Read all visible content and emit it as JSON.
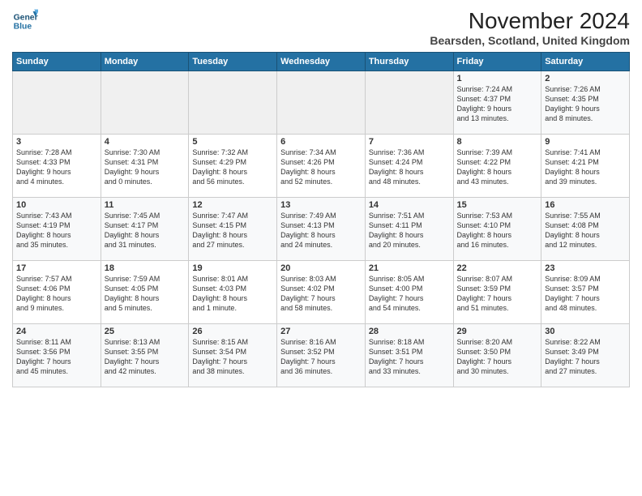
{
  "logo": {
    "line1": "General",
    "line2": "Blue"
  },
  "title": "November 2024",
  "location": "Bearsden, Scotland, United Kingdom",
  "headers": [
    "Sunday",
    "Monday",
    "Tuesday",
    "Wednesday",
    "Thursday",
    "Friday",
    "Saturday"
  ],
  "weeks": [
    [
      {
        "day": "",
        "info": ""
      },
      {
        "day": "",
        "info": ""
      },
      {
        "day": "",
        "info": ""
      },
      {
        "day": "",
        "info": ""
      },
      {
        "day": "",
        "info": ""
      },
      {
        "day": "1",
        "info": "Sunrise: 7:24 AM\nSunset: 4:37 PM\nDaylight: 9 hours\nand 13 minutes."
      },
      {
        "day": "2",
        "info": "Sunrise: 7:26 AM\nSunset: 4:35 PM\nDaylight: 9 hours\nand 8 minutes."
      }
    ],
    [
      {
        "day": "3",
        "info": "Sunrise: 7:28 AM\nSunset: 4:33 PM\nDaylight: 9 hours\nand 4 minutes."
      },
      {
        "day": "4",
        "info": "Sunrise: 7:30 AM\nSunset: 4:31 PM\nDaylight: 9 hours\nand 0 minutes."
      },
      {
        "day": "5",
        "info": "Sunrise: 7:32 AM\nSunset: 4:29 PM\nDaylight: 8 hours\nand 56 minutes."
      },
      {
        "day": "6",
        "info": "Sunrise: 7:34 AM\nSunset: 4:26 PM\nDaylight: 8 hours\nand 52 minutes."
      },
      {
        "day": "7",
        "info": "Sunrise: 7:36 AM\nSunset: 4:24 PM\nDaylight: 8 hours\nand 48 minutes."
      },
      {
        "day": "8",
        "info": "Sunrise: 7:39 AM\nSunset: 4:22 PM\nDaylight: 8 hours\nand 43 minutes."
      },
      {
        "day": "9",
        "info": "Sunrise: 7:41 AM\nSunset: 4:21 PM\nDaylight: 8 hours\nand 39 minutes."
      }
    ],
    [
      {
        "day": "10",
        "info": "Sunrise: 7:43 AM\nSunset: 4:19 PM\nDaylight: 8 hours\nand 35 minutes."
      },
      {
        "day": "11",
        "info": "Sunrise: 7:45 AM\nSunset: 4:17 PM\nDaylight: 8 hours\nand 31 minutes."
      },
      {
        "day": "12",
        "info": "Sunrise: 7:47 AM\nSunset: 4:15 PM\nDaylight: 8 hours\nand 27 minutes."
      },
      {
        "day": "13",
        "info": "Sunrise: 7:49 AM\nSunset: 4:13 PM\nDaylight: 8 hours\nand 24 minutes."
      },
      {
        "day": "14",
        "info": "Sunrise: 7:51 AM\nSunset: 4:11 PM\nDaylight: 8 hours\nand 20 minutes."
      },
      {
        "day": "15",
        "info": "Sunrise: 7:53 AM\nSunset: 4:10 PM\nDaylight: 8 hours\nand 16 minutes."
      },
      {
        "day": "16",
        "info": "Sunrise: 7:55 AM\nSunset: 4:08 PM\nDaylight: 8 hours\nand 12 minutes."
      }
    ],
    [
      {
        "day": "17",
        "info": "Sunrise: 7:57 AM\nSunset: 4:06 PM\nDaylight: 8 hours\nand 9 minutes."
      },
      {
        "day": "18",
        "info": "Sunrise: 7:59 AM\nSunset: 4:05 PM\nDaylight: 8 hours\nand 5 minutes."
      },
      {
        "day": "19",
        "info": "Sunrise: 8:01 AM\nSunset: 4:03 PM\nDaylight: 8 hours\nand 1 minute."
      },
      {
        "day": "20",
        "info": "Sunrise: 8:03 AM\nSunset: 4:02 PM\nDaylight: 7 hours\nand 58 minutes."
      },
      {
        "day": "21",
        "info": "Sunrise: 8:05 AM\nSunset: 4:00 PM\nDaylight: 7 hours\nand 54 minutes."
      },
      {
        "day": "22",
        "info": "Sunrise: 8:07 AM\nSunset: 3:59 PM\nDaylight: 7 hours\nand 51 minutes."
      },
      {
        "day": "23",
        "info": "Sunrise: 8:09 AM\nSunset: 3:57 PM\nDaylight: 7 hours\nand 48 minutes."
      }
    ],
    [
      {
        "day": "24",
        "info": "Sunrise: 8:11 AM\nSunset: 3:56 PM\nDaylight: 7 hours\nand 45 minutes."
      },
      {
        "day": "25",
        "info": "Sunrise: 8:13 AM\nSunset: 3:55 PM\nDaylight: 7 hours\nand 42 minutes."
      },
      {
        "day": "26",
        "info": "Sunrise: 8:15 AM\nSunset: 3:54 PM\nDaylight: 7 hours\nand 38 minutes."
      },
      {
        "day": "27",
        "info": "Sunrise: 8:16 AM\nSunset: 3:52 PM\nDaylight: 7 hours\nand 36 minutes."
      },
      {
        "day": "28",
        "info": "Sunrise: 8:18 AM\nSunset: 3:51 PM\nDaylight: 7 hours\nand 33 minutes."
      },
      {
        "day": "29",
        "info": "Sunrise: 8:20 AM\nSunset: 3:50 PM\nDaylight: 7 hours\nand 30 minutes."
      },
      {
        "day": "30",
        "info": "Sunrise: 8:22 AM\nSunset: 3:49 PM\nDaylight: 7 hours\nand 27 minutes."
      }
    ]
  ]
}
